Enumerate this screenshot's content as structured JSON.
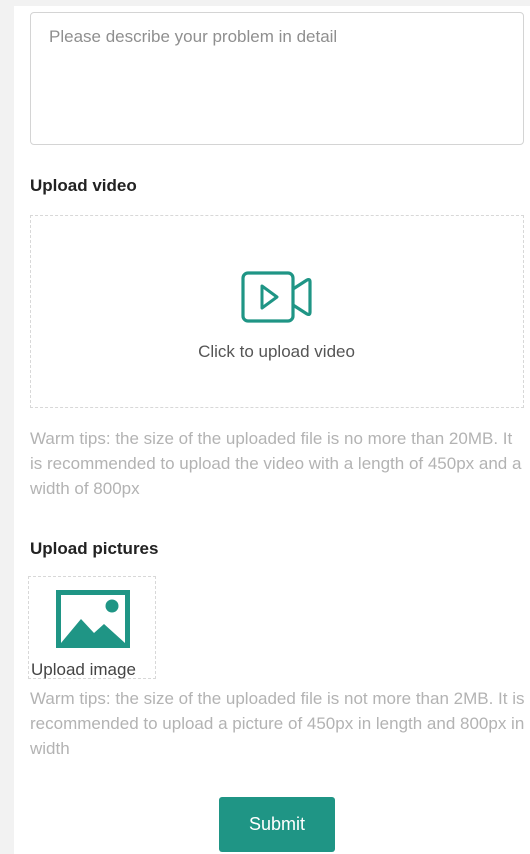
{
  "problem": {
    "placeholder": "Please describe your problem in detail",
    "value": ""
  },
  "video": {
    "title": "Upload video",
    "upload_label": "Click to upload video",
    "icon": "video-camera-icon",
    "tip": "Warm tips: the size of the uploaded file is no more than 20MB. It is recommended to upload the video with a length of 450px and a width of 800px"
  },
  "pictures": {
    "title": "Upload pictures",
    "upload_label": "Upload image",
    "icon": "image-icon",
    "tip": "Warm tips: the size of the uploaded file is not more than 2MB. It is recommended to upload a picture of 450px in length and 800px in width"
  },
  "submit": {
    "label": "Submit"
  },
  "colors": {
    "accent": "#1f9585",
    "tip_text": "#b3b3b3",
    "border": "#d4d4d4"
  }
}
